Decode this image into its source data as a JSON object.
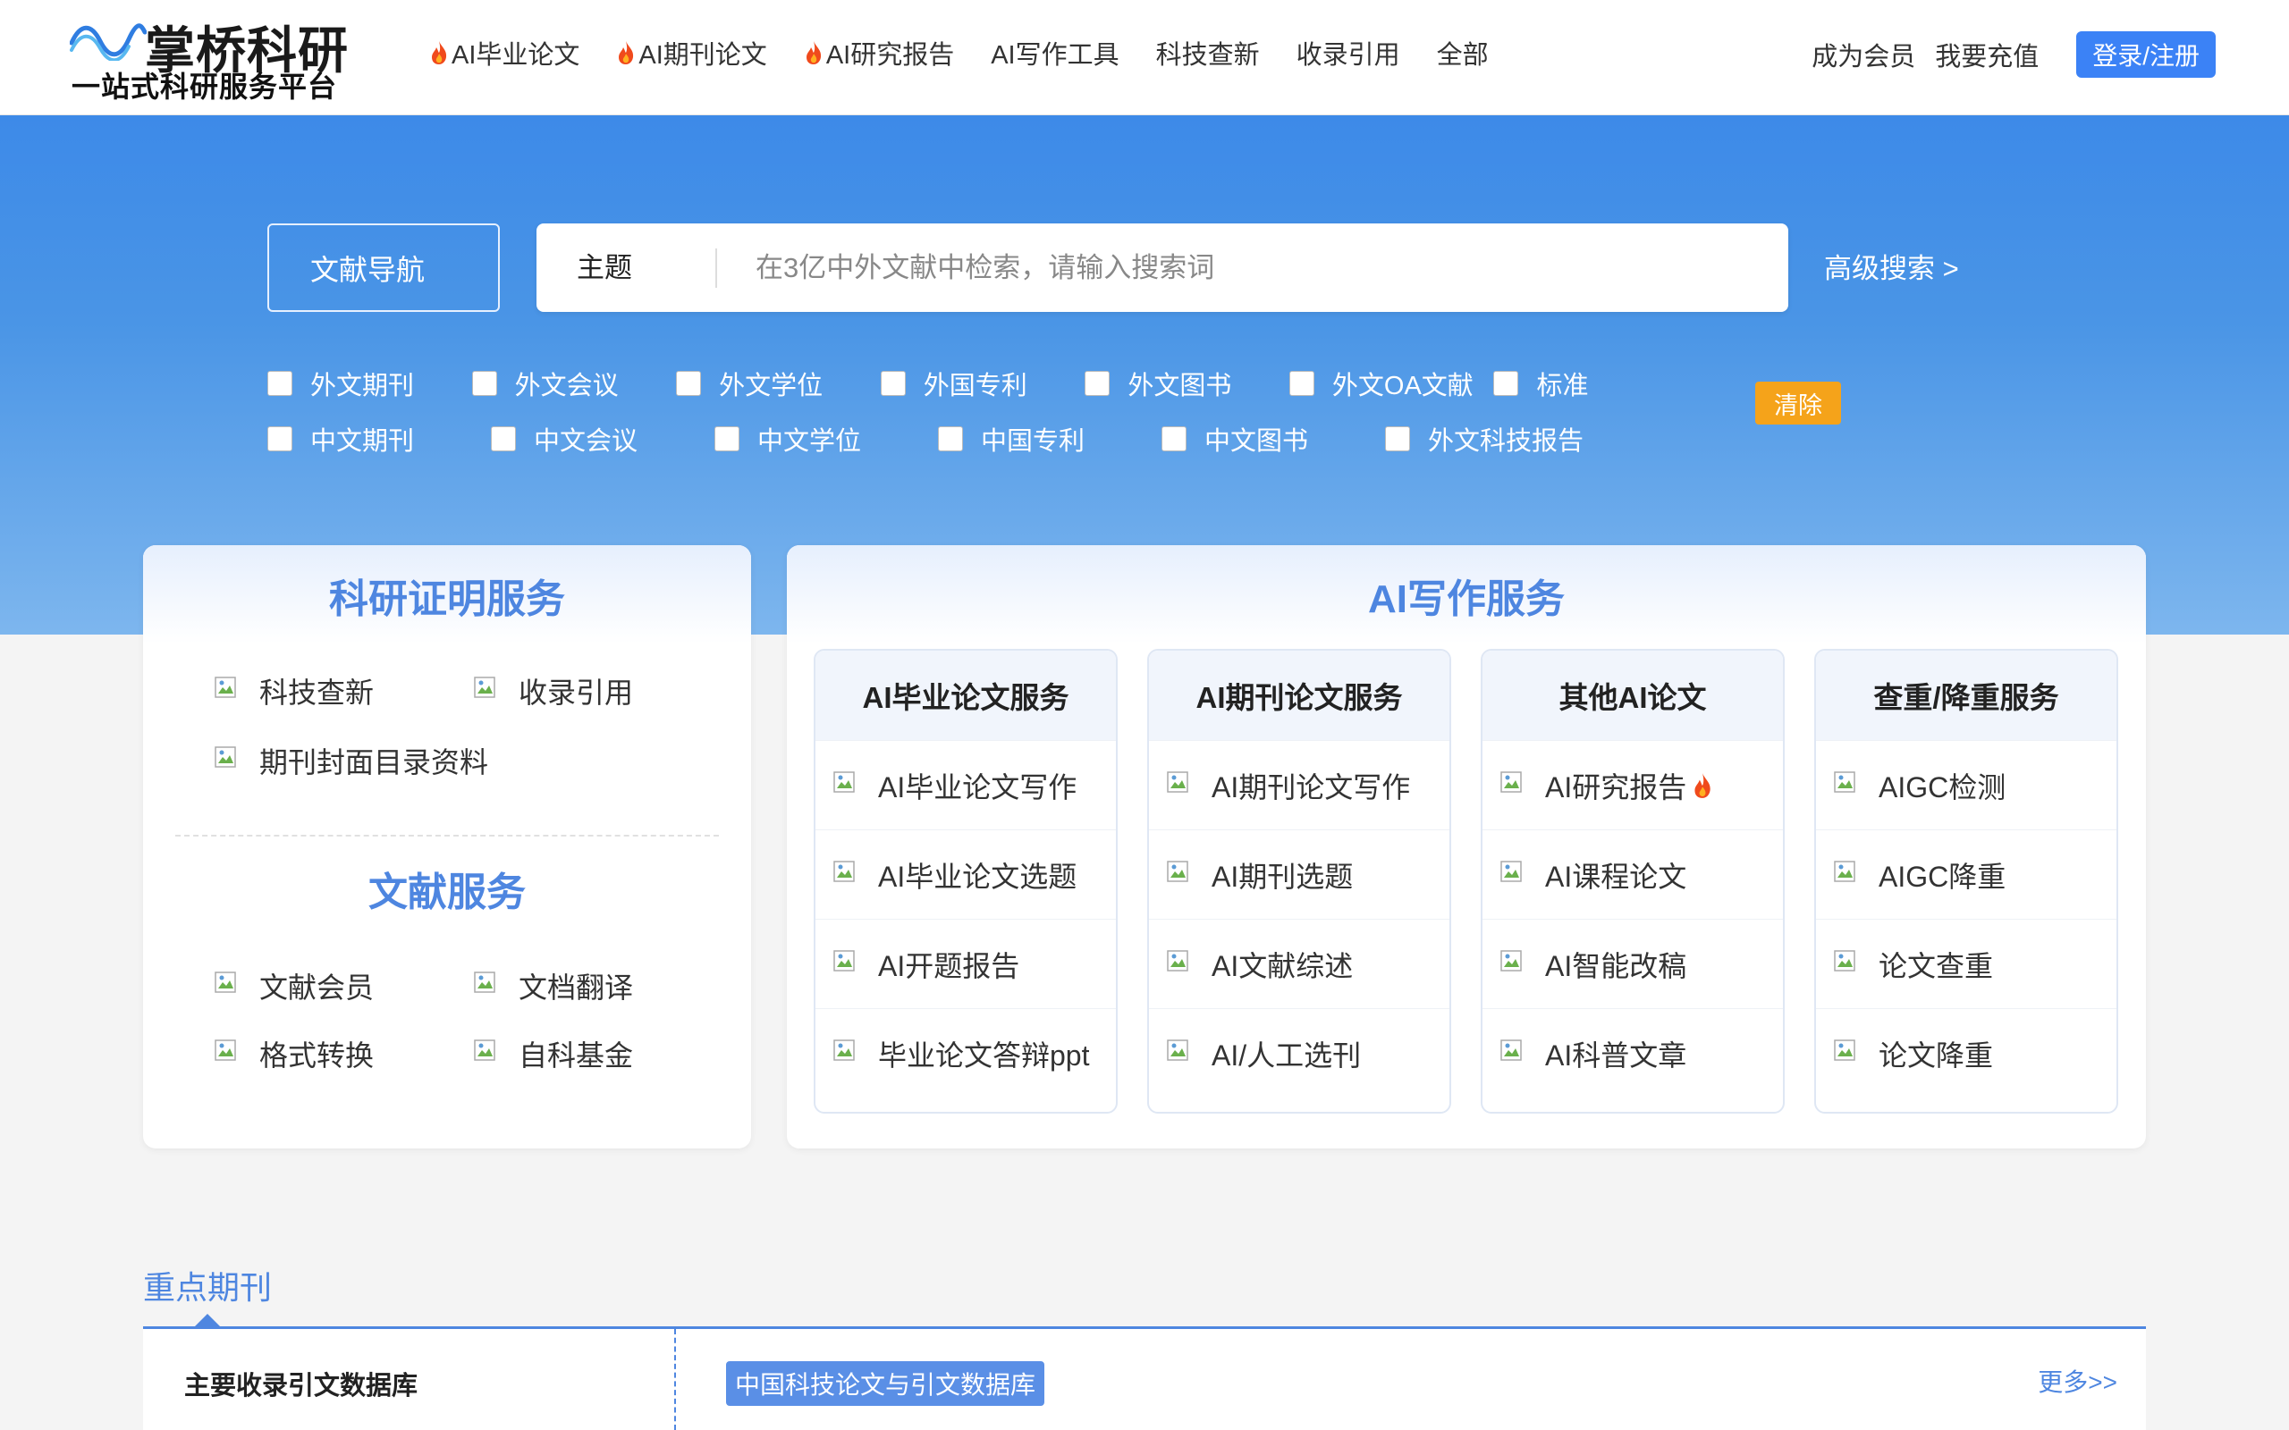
{
  "header": {
    "logo_title": "掌桥科研",
    "logo_subtitle": "一站式科研服务平台",
    "nav": [
      {
        "label": "AI毕业论文",
        "hot": true
      },
      {
        "label": "AI期刊论文",
        "hot": true
      },
      {
        "label": "AI研究报告",
        "hot": true
      },
      {
        "label": "AI写作工具",
        "hot": false
      },
      {
        "label": "科技查新",
        "hot": false
      },
      {
        "label": "收录引用",
        "hot": false
      },
      {
        "label": "全部",
        "hot": false
      }
    ],
    "member_link": "成为会员",
    "recharge_link": "我要充值",
    "login_button": "登录/注册"
  },
  "search": {
    "nav_button": "文献导航",
    "scope": "主题",
    "placeholder": "在3亿中外文献中检索，请输入搜索词",
    "value": "",
    "advanced": "高级搜索 >",
    "filters_row1": [
      "外文期刊",
      "外文会议",
      "外文学位",
      "外国专利",
      "外文图书",
      "外文OA文献",
      "标准"
    ],
    "filters_row2": [
      "中文期刊",
      "中文会议",
      "中文学位",
      "中国专利",
      "中文图书",
      "外文科技报告"
    ],
    "clear_button": "清除"
  },
  "research_cert": {
    "title": "科研证明服务",
    "items": [
      "科技查新",
      "收录引用",
      "期刊封面目录资料"
    ]
  },
  "literature": {
    "title": "文献服务",
    "items": [
      "文献会员",
      "文档翻译",
      "格式转换",
      "自科基金"
    ]
  },
  "ai_writing": {
    "title": "AI写作服务",
    "columns": [
      {
        "header": "AI毕业论文服务",
        "items": [
          "AI毕业论文写作",
          "AI毕业论文选题",
          "AI开题报告",
          "毕业论文答辩ppt"
        ]
      },
      {
        "header": "AI期刊论文服务",
        "items": [
          "AI期刊论文写作",
          "AI期刊选题",
          "AI文献综述",
          "AI/人工选刊"
        ]
      },
      {
        "header": "其他AI论文",
        "items": [
          "AI研究报告",
          "AI课程论文",
          "AI智能改稿",
          "AI科普文章"
        ]
      },
      {
        "header": "查重/降重服务",
        "items": [
          "AIGC检测",
          "AIGC降重",
          "论文查重",
          "论文降重"
        ]
      }
    ]
  },
  "journals": {
    "section_title": "重点期刊",
    "left_label": "主要收录引文数据库",
    "tag": "中国科技论文与引文数据库",
    "more": "更多>>"
  },
  "colors": {
    "accent": "#3b82f6",
    "hero_top": "#3d8ae8",
    "hero_bottom": "#7db6ee",
    "section_title": "#4e86e0",
    "clear_orange": "#f5a31a",
    "hot_icon": "fire-icon"
  }
}
